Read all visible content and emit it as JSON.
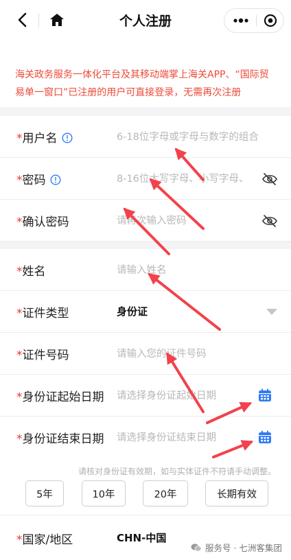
{
  "navbar": {
    "title": "个人注册",
    "back_icon": "chevron-left-icon",
    "home_icon": "home-icon",
    "more_icon": "more-dots-icon",
    "close_icon": "target-close-icon"
  },
  "notice": "海关政务服务一体化平台及其移动端掌上海关APP、“国际贸易单一窗口”已注册的用户可直接登录，无需再次注册",
  "required_mark": "*",
  "colors": {
    "notice": "#ec4a3a",
    "required": "#e53935",
    "accent": "#2f7bf5",
    "annotation_arrow": "#f2424c",
    "background_gap": "#f4f4f6"
  },
  "form": {
    "username": {
      "label": "用户名",
      "placeholder": "6-18位字母或字母与数字的组合"
    },
    "password": {
      "label": "密码",
      "placeholder": "8-16位大写字母、小写字母、"
    },
    "confirm_password": {
      "label": "确认密码",
      "placeholder": "请再次输入密码"
    },
    "name": {
      "label": "姓名",
      "placeholder": "请输入姓名"
    },
    "id_type": {
      "label": "证件类型",
      "value": "身份证"
    },
    "id_number": {
      "label": "证件号码",
      "placeholder": "请输入您的证件号码"
    },
    "id_start_date": {
      "label": "身份证起始日期",
      "placeholder": "请选择身份证起始日期"
    },
    "id_end_date": {
      "label": "身份证结束日期",
      "placeholder": "请选择身份证结束日期"
    },
    "validity_hint": "请核对身份证有效期，如与实体证件不符请手动调整。",
    "validity_buttons": [
      "5年",
      "10年",
      "20年",
      "长期有效"
    ],
    "country": {
      "label": "国家/地区",
      "value": "CHN-中国"
    }
  },
  "watermark": "服务号 · 七洲客集团"
}
